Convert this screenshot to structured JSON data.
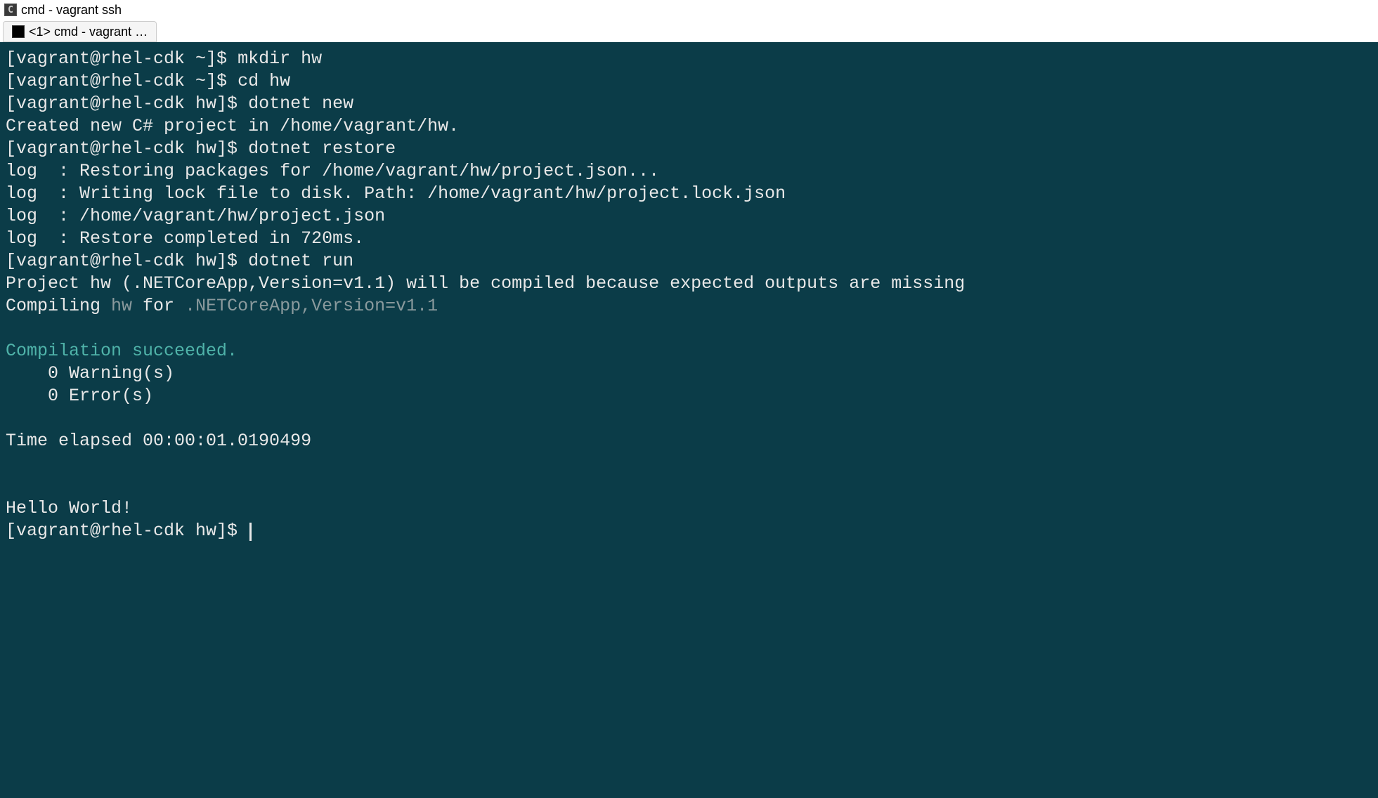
{
  "window": {
    "title": "cmd - vagrant ssh"
  },
  "tab": {
    "label": "<1> cmd - vagrant …"
  },
  "terminal": {
    "lines": [
      {
        "prompt": "[vagrant@rhel-cdk ~]$ ",
        "cmd": "mkdir hw"
      },
      {
        "prompt": "[vagrant@rhel-cdk ~]$ ",
        "cmd": "cd hw"
      },
      {
        "prompt": "[vagrant@rhel-cdk hw]$ ",
        "cmd": "dotnet new"
      },
      {
        "text": "Created new C# project in /home/vagrant/hw."
      },
      {
        "prompt": "[vagrant@rhel-cdk hw]$ ",
        "cmd": "dotnet restore"
      },
      {
        "text": "log  : Restoring packages for /home/vagrant/hw/project.json..."
      },
      {
        "text": "log  : Writing lock file to disk. Path: /home/vagrant/hw/project.lock.json"
      },
      {
        "text": "log  : /home/vagrant/hw/project.json"
      },
      {
        "text": "log  : Restore completed in 720ms."
      },
      {
        "prompt": "[vagrant@rhel-cdk hw]$ ",
        "cmd": "dotnet run"
      },
      {
        "text": "Project hw (.NETCoreApp,Version=v1.1) will be compiled because expected outputs are missing"
      },
      {
        "compile_prefix": "Compiling ",
        "compile_name": "hw",
        "compile_for": " for ",
        "compile_target": ".NETCoreApp,Version=v1.1"
      },
      {
        "text": ""
      },
      {
        "teal": "Compilation succeeded."
      },
      {
        "text": "    0 Warning(s)"
      },
      {
        "text": "    0 Error(s)"
      },
      {
        "text": ""
      },
      {
        "text": "Time elapsed 00:00:01.0190499"
      },
      {
        "text": ""
      },
      {
        "text": ""
      },
      {
        "text": "Hello World!"
      },
      {
        "prompt": "[vagrant@rhel-cdk hw]$ ",
        "cursor": true
      }
    ]
  }
}
